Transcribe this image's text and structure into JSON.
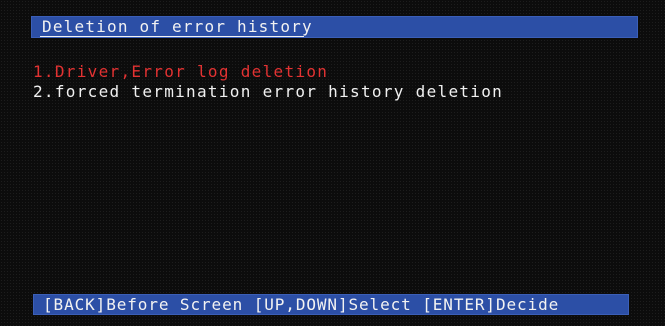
{
  "title_bar": {
    "title": "Deletion of error history"
  },
  "menu": {
    "items": [
      {
        "label": "1.Driver,Error log deletion",
        "state": "selected"
      },
      {
        "label": "2.forced termination error history deletion",
        "state": "normal"
      }
    ]
  },
  "footer": {
    "hints": [
      {
        "key": "[BACK]",
        "action": "Before Screen"
      },
      {
        "key": "[UP,DOWN]",
        "action": "Select"
      },
      {
        "key": "[ENTER]",
        "action": "Decide"
      }
    ]
  },
  "colors": {
    "background": "#0c0c0c",
    "bar": "#2c4fa6",
    "selected_text": "#e23232",
    "normal_text": "#f0f0f0"
  }
}
